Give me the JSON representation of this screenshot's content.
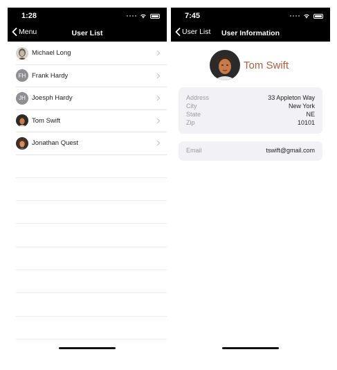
{
  "left_screen": {
    "status_time": "1:28",
    "nav": {
      "back_label": "Menu",
      "title": "User List"
    },
    "users": [
      {
        "name": "Michael Long",
        "avatar": "photo"
      },
      {
        "name": "Frank Hardy",
        "avatar": "initials",
        "initials": "FH"
      },
      {
        "name": "Joesph Hardy",
        "avatar": "initials",
        "initials": "JH"
      },
      {
        "name": "Tom Swift",
        "avatar": "photo"
      },
      {
        "name": "Jonathan Quest",
        "avatar": "photo"
      }
    ]
  },
  "right_screen": {
    "status_time": "7:45",
    "nav": {
      "back_label": "User List",
      "title": "User Information"
    },
    "profile_name": "Tom Swift",
    "address": {
      "address_label": "Address",
      "address_value": "33 Appleton Way",
      "city_label": "City",
      "city_value": "New York",
      "state_label": "State",
      "state_value": "NE",
      "zip_label": "Zip",
      "zip_value": "10101"
    },
    "contact": {
      "email_label": "Email",
      "email_value": "tswift@gmail.com"
    }
  },
  "colors": {
    "nav_background": "#000000",
    "profile_name_color": "#b35c3c",
    "card_background": "#f2f2f6",
    "separator": "#e3e3e6"
  },
  "icons": [
    "back-chevron-icon",
    "wifi-icon",
    "battery-icon",
    "cellular-dots-icon",
    "disclosure-chevron-icon"
  ]
}
